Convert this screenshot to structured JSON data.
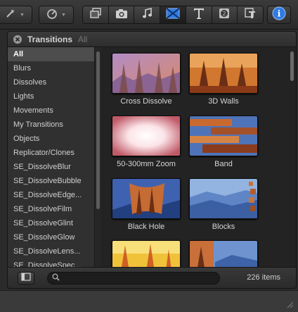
{
  "colors": {
    "accent_blue": "#2f7be3",
    "selected_row": "#4d4d4d",
    "panel_bg": "#262626"
  },
  "toolbar": {
    "tools": [
      {
        "icon": "magic-wand-icon"
      },
      {
        "icon": "speedometer-icon"
      }
    ],
    "browser_buttons": [
      {
        "icon": "clips-icon"
      },
      {
        "icon": "camera-icon"
      },
      {
        "icon": "music-note-icon"
      },
      {
        "icon": "transitions-icon",
        "active": true
      },
      {
        "icon": "title-icon"
      },
      {
        "icon": "generator-icon"
      },
      {
        "icon": "themes-icon"
      }
    ],
    "inspector_icon": "info-icon"
  },
  "panel": {
    "title": "Transitions",
    "subtitle": "All"
  },
  "sidebar": {
    "items": [
      {
        "label": "All",
        "selected": true
      },
      {
        "label": "Blurs"
      },
      {
        "label": "Dissolves"
      },
      {
        "label": "Lights"
      },
      {
        "label": "Movements"
      },
      {
        "label": "My Transitions"
      },
      {
        "label": "Objects"
      },
      {
        "label": "Replicator/Clones"
      },
      {
        "label": "SE_DissolveBlur"
      },
      {
        "label": "SE_DissolveBubble"
      },
      {
        "label": "SE_DissolveEdge..."
      },
      {
        "label": "SE_DissolveFilm"
      },
      {
        "label": "SE_DissolveGlint"
      },
      {
        "label": "SE_DissolveGlow"
      },
      {
        "label": "SE_DissolveLens..."
      },
      {
        "label": "SE_DissolveSpec..."
      }
    ]
  },
  "transitions": [
    {
      "label": "Cross Dissolve"
    },
    {
      "label": "3D Walls"
    },
    {
      "label": "50-300mm Zoom"
    },
    {
      "label": "Band"
    },
    {
      "label": "Black Hole"
    },
    {
      "label": "Blocks"
    },
    {
      "label": ""
    },
    {
      "label": ""
    }
  ],
  "footer": {
    "search_placeholder": "",
    "item_count": "226 items"
  }
}
